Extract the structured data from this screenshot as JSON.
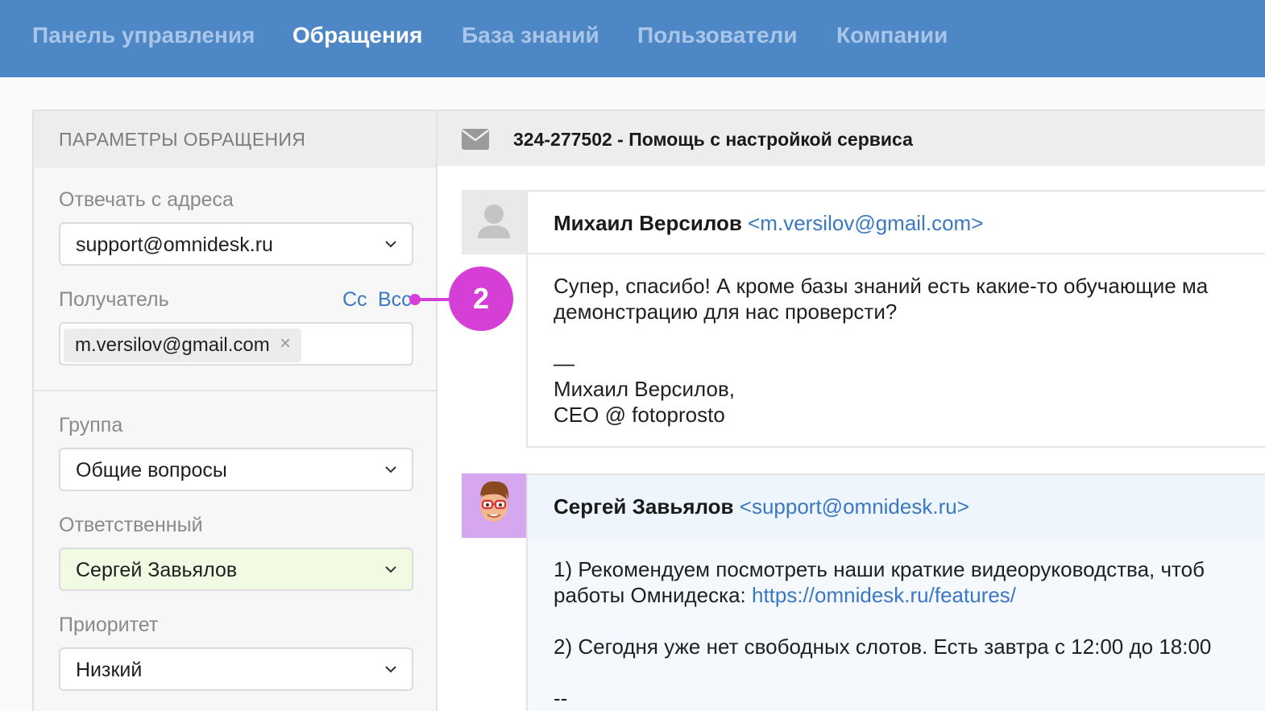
{
  "nav": {
    "items": [
      {
        "label": "Панель управления"
      },
      {
        "label": "Обращения"
      },
      {
        "label": "База знаний"
      },
      {
        "label": "Пользователи"
      },
      {
        "label": "Компании"
      }
    ],
    "active": "Обращения"
  },
  "sidebar": {
    "header": "ПАРАМЕТРЫ ОБРАЩЕНИЯ",
    "reply_from": {
      "label": "Отвечать с адреса",
      "value": "support@omnidesk.ru"
    },
    "recipient": {
      "label": "Получатель",
      "cc": "Cc",
      "bcc": "Bcc",
      "tag": "m.versilov@gmail.com",
      "remove_icon": "×"
    },
    "group": {
      "label": "Группа",
      "value": "Общие вопросы"
    },
    "assignee": {
      "label": "Ответственный",
      "value": "Сергей Завьялов"
    },
    "priority": {
      "label": "Приоритет",
      "value": "Низкий"
    }
  },
  "ticket": {
    "title": "324-277502 - Помощь с настройкой сервиса",
    "icon": "envelope-icon"
  },
  "messages": [
    {
      "sender_name": "Михаил Версилов",
      "sender_email": "<m.versilov@gmail.com>",
      "lines": [
        "Супер, спасибо! А кроме базы знаний есть какие-то обучающие ма",
        "демонстрацию для нас проверсти?",
        "—",
        "Михаил Версилов,",
        "CEO @ fotoprosto"
      ]
    },
    {
      "sender_name": "Сергей Завьялов",
      "sender_email": "<support@omnidesk.ru>",
      "line1": "1) Рекомендуем посмотреть наши краткие видеоруководства, чтоб",
      "line2_prefix": "работы Омнидеска: ",
      "line2_link": "https://omnidesk.ru/features/",
      "line3": "2) Сегодня уже нет свободных слотов. Есть завтра с 12:00 до 18:00",
      "line4": "--"
    }
  ],
  "callout": {
    "number": "2",
    "color": "#d63fd6"
  },
  "colors": {
    "nav_bg": "#4e87c6",
    "link": "#3a78c3",
    "assignee_bg": "#f1fbe3"
  }
}
